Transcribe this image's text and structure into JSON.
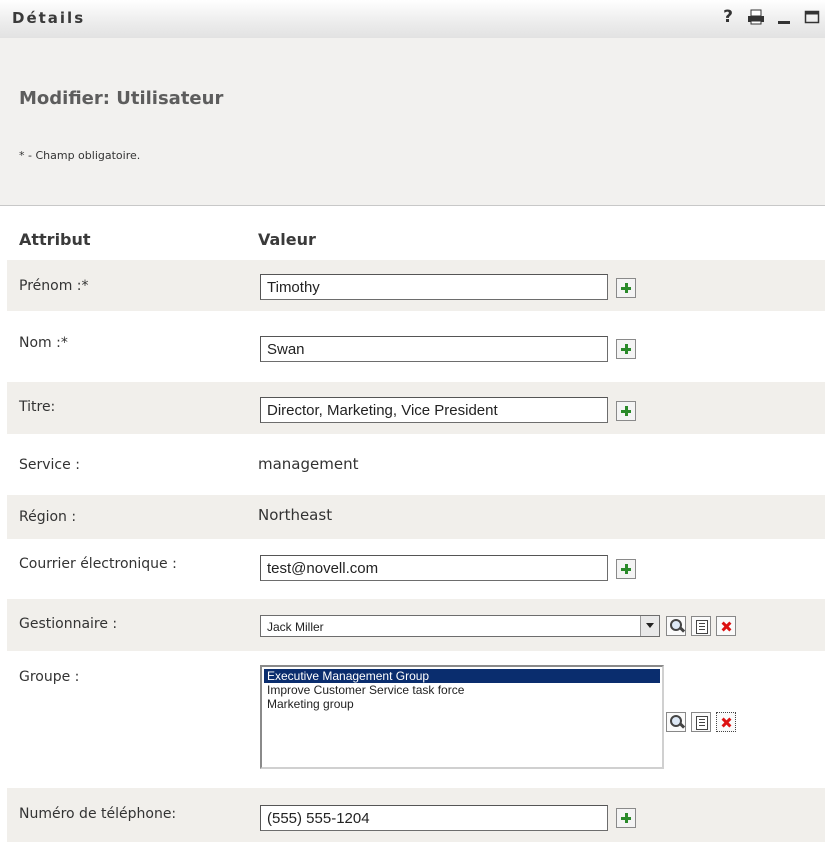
{
  "window": {
    "title": "Détails",
    "icons": [
      "help-icon",
      "print-icon",
      "minimize-icon",
      "maximize-icon"
    ],
    "help_glyph": "?"
  },
  "header": {
    "heading": "Modifier: Utilisateur",
    "required_note": "* - Champ obligatoire."
  },
  "columns": {
    "attribute": "Attribut",
    "value": "Valeur"
  },
  "fields": {
    "first_name": {
      "label": "Prénom :*",
      "value": "Timothy"
    },
    "last_name": {
      "label": "Nom :*",
      "value": "Swan"
    },
    "title": {
      "label": "Titre:",
      "value": "Director, Marketing, Vice President"
    },
    "department": {
      "label": "Service :",
      "value": "management"
    },
    "region": {
      "label": "Région :",
      "value": "Northeast"
    },
    "email": {
      "label": "Courrier électronique :",
      "value": "test@novell.com"
    },
    "manager": {
      "label": "Gestionnaire :",
      "value": "Jack Miller"
    },
    "group": {
      "label": "Groupe :",
      "options": [
        {
          "label": "Executive Management Group",
          "selected": true
        },
        {
          "label": "Improve Customer Service task force",
          "selected": false
        },
        {
          "label": "Marketing group",
          "selected": false
        }
      ]
    },
    "phone": {
      "label": "Numéro de téléphone:",
      "value": "(555) 555-1204"
    }
  },
  "colors": {
    "row_shade": "#f1efeb",
    "header_bg": "#f2f1ef",
    "selection": "#0a2d6e",
    "add_green": "#2a8a2a",
    "delete_red": "#d11111"
  }
}
